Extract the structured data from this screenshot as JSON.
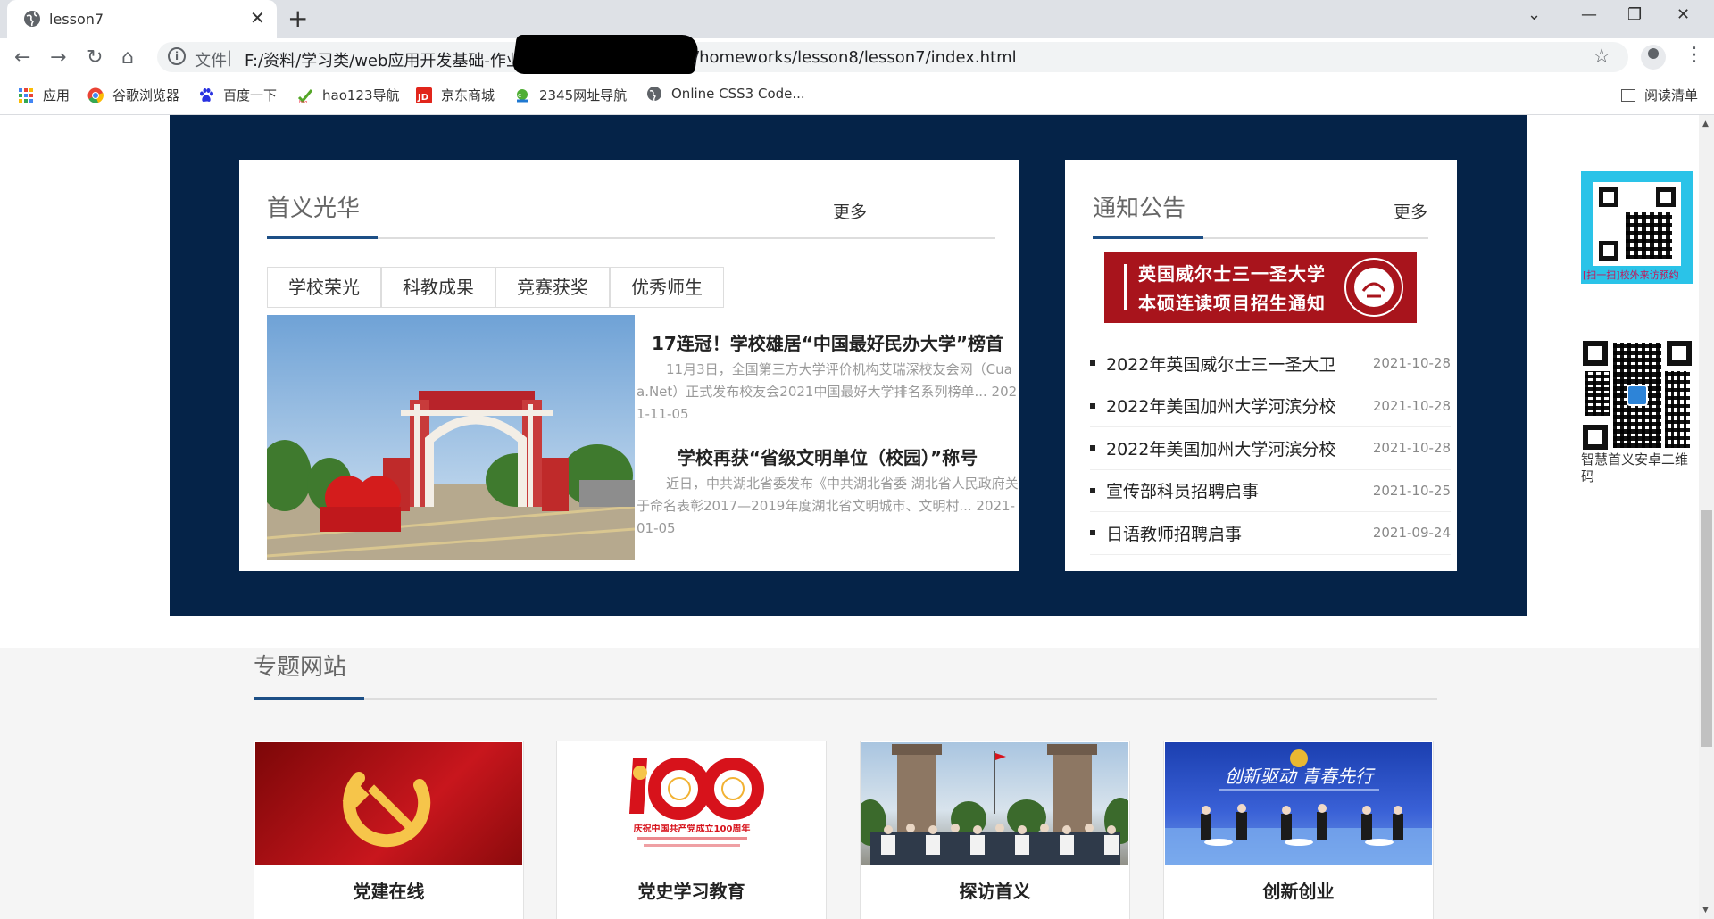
{
  "browser": {
    "tab_title": "lesson7",
    "scheme_label": "文件",
    "url_prefix": "F:/资料/学习类/web应用开发基础-作业",
    "url_suffix": "/homeworks/lesson8/lesson7/index.html"
  },
  "bookmarks": {
    "items": [
      "应用",
      "谷歌浏览器",
      "百度一下",
      "hao123导航",
      "京东商城",
      "2345网址导航",
      "Online CSS3 Code..."
    ],
    "reading_list": "阅读清单"
  },
  "glory": {
    "title": "首义光华",
    "more": "更多",
    "tabs": [
      "学校荣光",
      "科教成果",
      "竞赛获奖",
      "优秀师生"
    ],
    "news": [
      {
        "title": "17连冠！学校雄居“中国最好民办大学”榜首",
        "summary": "11月3日，全国第三方大学评价机构艾瑞深校友会网（Cuaa.Net）正式发布校友会2021中国最好大学排名系列榜单... 2021-11-05"
      },
      {
        "title": "学校再获“省级文明单位（校园）”称号",
        "summary": "近日，中共湖北省委发布《中共湖北省委 湖北省人民政府关于命名表彰2017—2019年度湖北省文明城市、文明村... 2021-01-05"
      }
    ]
  },
  "notice": {
    "title": "通知公告",
    "more": "更多",
    "banner_line1": "英国威尔士三一圣大学",
    "banner_line2": "本硕连读项目招生通知",
    "items": [
      {
        "title": "2022年英国威尔士三一圣大卫",
        "date": "2021-10-28"
      },
      {
        "title": "2022年美国加州大学河滨分校",
        "date": "2021-10-28"
      },
      {
        "title": "2022年美国加州大学河滨分校",
        "date": "2021-10-28"
      },
      {
        "title": "宣传部科员招聘启事",
        "date": "2021-10-25"
      },
      {
        "title": "日语教师招聘启事",
        "date": "2021-09-24"
      }
    ]
  },
  "qr": {
    "wechat_caption": "[扫一扫]校外来访预约",
    "app_caption": "智慧首义安卓二维码"
  },
  "topics": {
    "title": "专题网站",
    "cards": [
      "党建在线",
      "党史学习教育",
      "探访首义",
      "创新创业"
    ],
    "party_logo_caption": "庆祝中国共产党成立100周年",
    "innovation_banner": "创新驱动 青春先行"
  },
  "colors": {
    "navy": "#052348",
    "accent": "#1d4f86",
    "banner_red": "#a8141c"
  }
}
